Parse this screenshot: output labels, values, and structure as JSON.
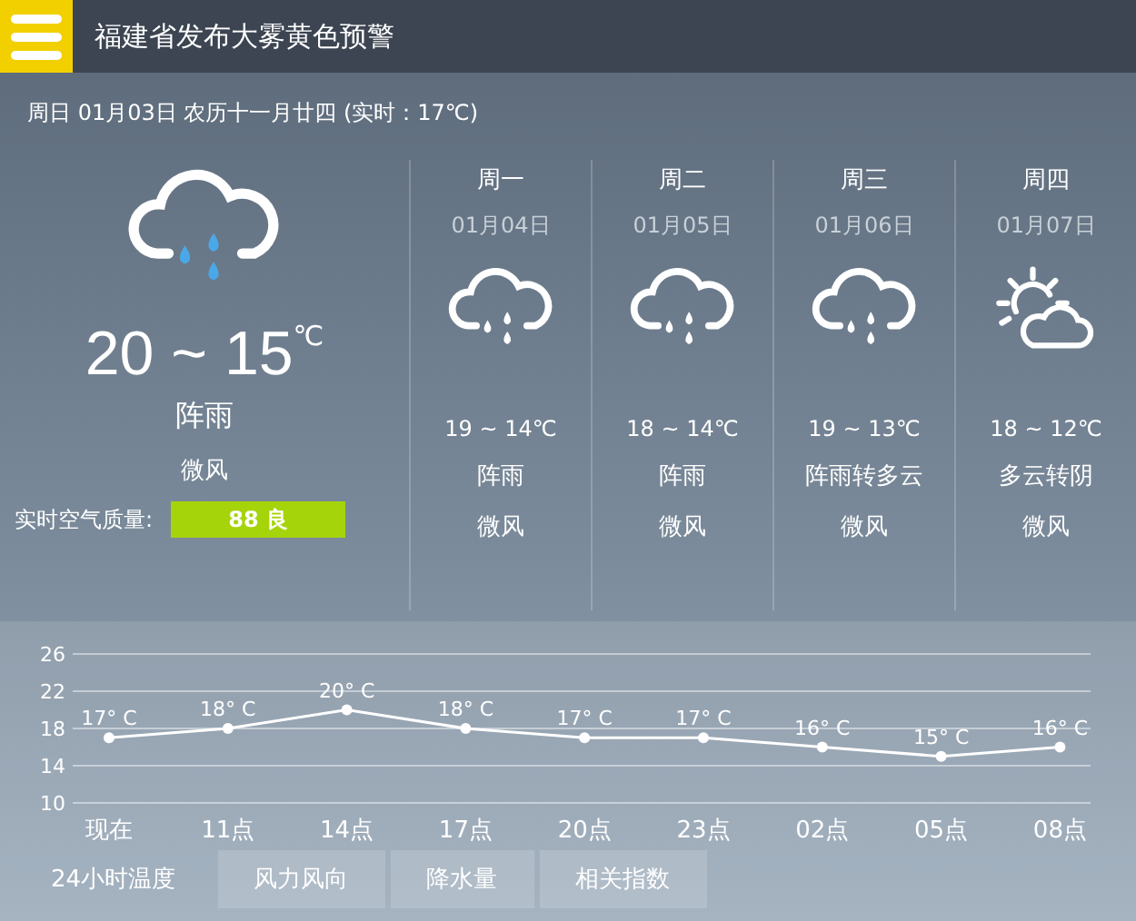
{
  "header": {
    "title": "福建省发布大雾黄色预警"
  },
  "date_line": "周日 01月03日 农历十一月廿四 (实时：17℃)",
  "today": {
    "kind": "rain",
    "temp": "20 ~ 15",
    "unit": "℃",
    "weather": "阵雨",
    "wind": "微风",
    "aqi_label": "实时空气质量:",
    "aqi_value": "88 良"
  },
  "forecast": [
    {
      "day": "周一",
      "date": "01月04日",
      "kind": "rain",
      "temp": "19 ~ 14℃",
      "weather": "阵雨",
      "wind": "微风"
    },
    {
      "day": "周二",
      "date": "01月05日",
      "kind": "rain",
      "temp": "18 ~ 14℃",
      "weather": "阵雨",
      "wind": "微风"
    },
    {
      "day": "周三",
      "date": "01月06日",
      "kind": "rain",
      "temp": "19 ~ 13℃",
      "weather": "阵雨转多云",
      "wind": "微风"
    },
    {
      "day": "周四",
      "date": "01月07日",
      "kind": "sun_cloud",
      "temp": "18 ~ 12℃",
      "weather": "多云转阴",
      "wind": "微风"
    }
  ],
  "chart": {
    "chart_data": {
      "type": "line",
      "categories": [
        "现在",
        "11点",
        "14点",
        "17点",
        "20点",
        "23点",
        "02点",
        "05点",
        "08点"
      ],
      "grid": true,
      "series": [
        {
          "color": "#ffffff",
          "marker": true,
          "values": [
            17,
            18,
            20,
            18,
            17,
            17,
            16,
            15,
            16
          ]
        }
      ],
      "ylim": [
        10,
        26
      ],
      "yticks": [
        10,
        14,
        18,
        22,
        26
      ],
      "value_labels": [
        "17° C",
        "18° C",
        "20° C",
        "18° C",
        "17° C",
        "17° C",
        "16° C",
        "15° C",
        "16° C"
      ]
    }
  },
  "tabs": [
    {
      "label": "24小时温度",
      "selected": true
    },
    {
      "label": "风力风向",
      "selected": false
    },
    {
      "label": "降水量",
      "selected": false
    },
    {
      "label": "相关指数",
      "selected": false
    }
  ]
}
